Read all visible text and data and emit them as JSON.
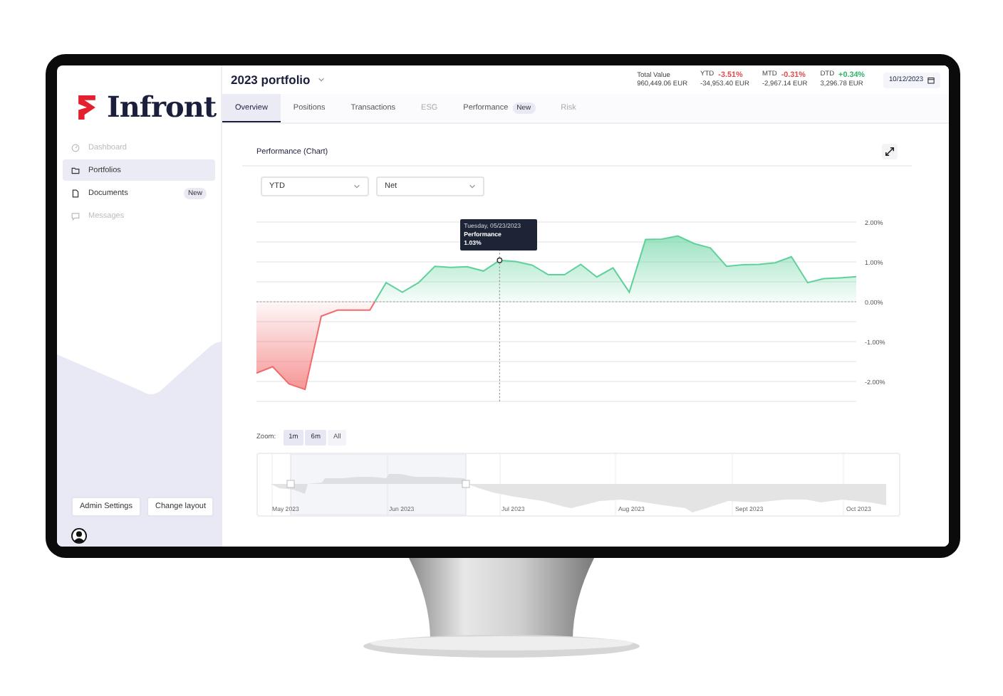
{
  "sidebar": {
    "logo": "Infront",
    "items": [
      {
        "label": "Dashboard",
        "kind": "dashboard",
        "selected": false,
        "disabled": true
      },
      {
        "label": "Portfolios",
        "kind": "folder",
        "selected": true,
        "disabled": false
      },
      {
        "label": "Documents",
        "kind": "document",
        "selected": false,
        "disabled": false,
        "badge": "New"
      },
      {
        "label": "Messages",
        "kind": "message",
        "selected": false,
        "disabled": true
      }
    ],
    "buttons": [
      "Admin Settings",
      "Change layout"
    ]
  },
  "header": {
    "title": "2023 portfolio",
    "stats": [
      {
        "label": "Total Value",
        "value": "960,449.06 EUR"
      },
      {
        "label": "YTD",
        "change": "-3.51%",
        "color": "#e5484d",
        "value": "-34,953.40 EUR"
      },
      {
        "label": "MTD",
        "change": "-0.31%",
        "color": "#e5484d",
        "value": "-2,967.14 EUR"
      },
      {
        "label": "DTD",
        "change": "+0.34%",
        "color": "#2fb36a",
        "value": "3,296.78 EUR"
      }
    ],
    "date": "10/12/2023"
  },
  "tabs": [
    {
      "label": "Overview",
      "selected": true,
      "disabled": false
    },
    {
      "label": "Positions",
      "selected": false,
      "disabled": false
    },
    {
      "label": "Transactions",
      "selected": false,
      "disabled": false
    },
    {
      "label": "ESG",
      "selected": false,
      "disabled": true
    },
    {
      "label": "Performance",
      "selected": false,
      "disabled": false,
      "badge": "New"
    },
    {
      "label": "Risk",
      "selected": false,
      "disabled": true
    }
  ],
  "card": {
    "title": "Performance (Chart)",
    "filters": [
      "YTD",
      "Net"
    ],
    "tooltip_value": "1.03%",
    "chart_data": {
      "type": "area",
      "grid": true,
      "ylim": [
        -2.5,
        2
      ],
      "yticks": [
        {
          "value": 2,
          "label": "2.00%"
        },
        {
          "value": 1,
          "label": "1.00%"
        },
        {
          "value": 0,
          "label": "0.00%"
        },
        {
          "value": -1,
          "label": "-1.00%"
        },
        {
          "value": -2,
          "label": "-2.00%"
        }
      ],
      "series": [
        {
          "name": "Performance",
          "color": "#5fd19b",
          "values": [
            -1.79,
            -1.63,
            -2.06,
            -2.2,
            -0.36,
            -0.21,
            -0.21,
            -0.21,
            0.48,
            0.24,
            0.48,
            0.89,
            0.86,
            0.88,
            0.77,
            1.04,
            1.01,
            0.92,
            0.68,
            0.68,
            0.94,
            0.62,
            0.85,
            0.24,
            1.56,
            1.57,
            1.65,
            1.46,
            1.35,
            0.89,
            0.93,
            0.94,
            0.98,
            1.13,
            0.48,
            0.58,
            0.6,
            0.63
          ]
        }
      ],
      "annotations": [
        "Tuesday, 05/23/2023"
      ]
    },
    "zoom": {
      "label": "Zoom:",
      "options": [
        {
          "label": "1m",
          "selected": true
        },
        {
          "label": "6m",
          "selected": true
        },
        {
          "label": "All",
          "selected": false
        }
      ]
    },
    "navigator": {
      "labels": [
        "May 2023",
        "Jun 2023",
        "Jul 2023",
        "Aug 2023",
        "Sept 2023",
        "Oct 2023"
      ]
    }
  }
}
